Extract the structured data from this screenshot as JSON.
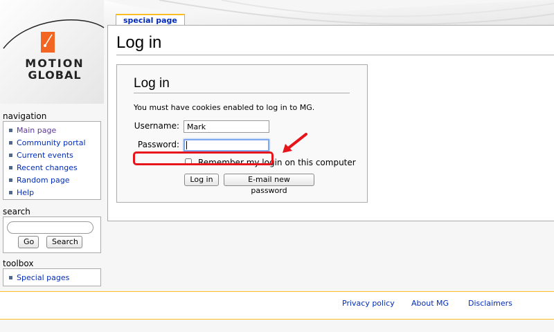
{
  "logo": {
    "line1": "MOTION",
    "line2": "GLOBAL"
  },
  "tab": {
    "label": "special page"
  },
  "page": {
    "title": "Log in"
  },
  "login": {
    "heading": "Log in",
    "cookie_note": "You must have cookies enabled to log in to MG.",
    "username_label": "Username:",
    "username_value": "Mark",
    "password_label": "Password:",
    "password_value": "",
    "remember_label": "Remember my login on this computer",
    "remember_checked": false,
    "login_button": "Log in",
    "email_button": "E-mail new password"
  },
  "sidebar": {
    "navigation": {
      "title": "navigation",
      "items": [
        "Main page",
        "Community portal",
        "Current events",
        "Recent changes",
        "Random page",
        "Help"
      ]
    },
    "search": {
      "title": "search",
      "go_button": "Go",
      "search_button": "Search",
      "placeholder": ""
    },
    "toolbox": {
      "title": "toolbox",
      "items": [
        "Special pages"
      ]
    }
  },
  "footer": {
    "links": [
      "Privacy policy",
      "About MG",
      "Disclaimers"
    ]
  },
  "colors": {
    "annotation": "#e8141c",
    "link": "#002bb8",
    "accent": "#f26522",
    "tab_border": "#fabd23"
  }
}
